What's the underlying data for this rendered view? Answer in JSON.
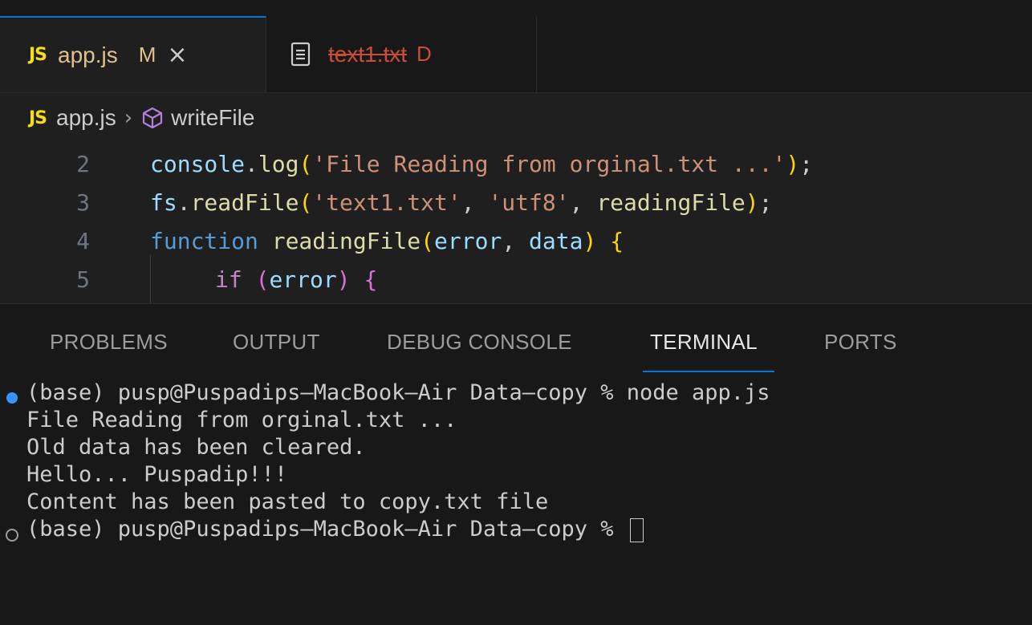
{
  "tabs": [
    {
      "badge": "JS",
      "title": "app.js",
      "status": "M",
      "close": "×"
    },
    {
      "title": "text1.txt",
      "status": "D"
    }
  ],
  "breadcrumb": {
    "badge": "JS",
    "file": "app.js",
    "separator": "›",
    "symbol": "writeFile"
  },
  "editor": {
    "lines": [
      {
        "number": "2"
      },
      {
        "number": "3"
      },
      {
        "number": "4"
      },
      {
        "number": "5"
      }
    ],
    "tokens": {
      "l2": [
        "console",
        ".",
        "log",
        "(",
        "'File Reading from orginal.txt ...'",
        ")",
        ";"
      ],
      "l3": [
        "fs",
        ".",
        "readFile",
        "(",
        "'text1.txt'",
        ", ",
        "'utf8'",
        ", ",
        "readingFile",
        ")",
        ";"
      ],
      "l4": [
        "function",
        " ",
        "readingFile",
        "(",
        "error",
        ", ",
        "data",
        ")",
        " ",
        "{"
      ],
      "l5": [
        "if",
        " ",
        "(",
        "error",
        ")",
        " ",
        "{"
      ]
    }
  },
  "panel": {
    "tabs": [
      "PROBLEMS",
      "OUTPUT",
      "DEBUG CONSOLE",
      "TERMINAL",
      "PORTS"
    ],
    "active_tab": "TERMINAL"
  },
  "terminal": {
    "lines": [
      "(base) pusp@Puspadips—MacBook—Air Data—copy % node app.js",
      "File Reading from orginal.txt ...",
      "Old data has been cleared.",
      "Hello... Puspadip!!!",
      "Content has been pasted to copy.txt file",
      "(base) pusp@Puspadips—MacBook—Air Data—copy %"
    ]
  },
  "colors": {
    "accent": "#0078d4",
    "modified": "#e2c08d",
    "deleted": "#c74e39",
    "js_badge": "#f5de19"
  }
}
